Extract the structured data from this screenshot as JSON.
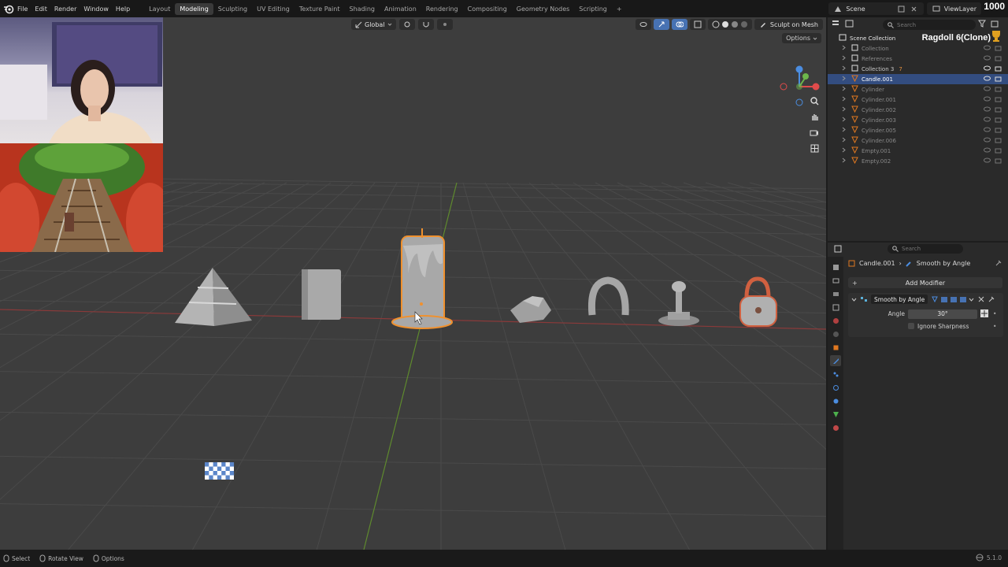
{
  "menu": {
    "items": [
      "File",
      "Edit",
      "Render",
      "Window",
      "Help"
    ]
  },
  "workspaces": {
    "tabs": [
      "Layout",
      "Modeling",
      "Sculpting",
      "UV Editing",
      "Texture Paint",
      "Shading",
      "Animation",
      "Rendering",
      "Compositing",
      "Geometry Nodes",
      "Scripting"
    ],
    "active": "Modeling",
    "add": "+"
  },
  "topright": {
    "scene": "Scene",
    "view_layer": "ViewLayer",
    "corner_number": "1000"
  },
  "viewport": {
    "transform_orientation": "Global",
    "sculpt_on_mesh": "Sculpt on Mesh",
    "options": "Options",
    "gizmo_colors": {
      "x": "#e04b4b",
      "y": "#6db64b",
      "z": "#4b8de0"
    }
  },
  "overlay": {
    "ragdoll": "Ragdoll 6(Clone)"
  },
  "outliner": {
    "title": "Scene Collection",
    "search_placeholder": "Search",
    "rows": [
      {
        "name": "Collection",
        "dim": true,
        "indent": 1
      },
      {
        "name": "References",
        "dim": true,
        "indent": 1
      },
      {
        "name": "Collection 3",
        "dim": false,
        "indent": 1,
        "badge": "7"
      },
      {
        "name": "Candle.001",
        "dim": false,
        "indent": 1,
        "selected": true
      },
      {
        "name": "Cylinder",
        "dim": true,
        "indent": 1
      },
      {
        "name": "Cylinder.001",
        "dim": true,
        "indent": 1
      },
      {
        "name": "Cylinder.002",
        "dim": true,
        "indent": 1
      },
      {
        "name": "Cylinder.003",
        "dim": true,
        "indent": 1
      },
      {
        "name": "Cylinder.005",
        "dim": true,
        "indent": 1
      },
      {
        "name": "Cylinder.006",
        "dim": true,
        "indent": 1
      },
      {
        "name": "Empty.001",
        "dim": true,
        "indent": 1
      },
      {
        "name": "Empty.002",
        "dim": true,
        "indent": 1
      }
    ]
  },
  "properties": {
    "search_placeholder": "Search",
    "object_name": "Candle.001",
    "modifier_crumb": "Smooth by Angle",
    "add_modifier": "Add Modifier",
    "add_modifier_plus": "+",
    "modifier": {
      "name": "Smooth by Angle",
      "angle_label": "Angle",
      "angle_value": "30°",
      "ignore_sharpness": "Ignore Sharpness"
    }
  },
  "statusbar": {
    "select": "Select",
    "rotate_view": "Rotate View",
    "options": "Options",
    "version": "5.1.0"
  },
  "colors": {
    "accent": "#4772b3",
    "selection": "#334d80",
    "orange_outline": "#f0912e"
  }
}
